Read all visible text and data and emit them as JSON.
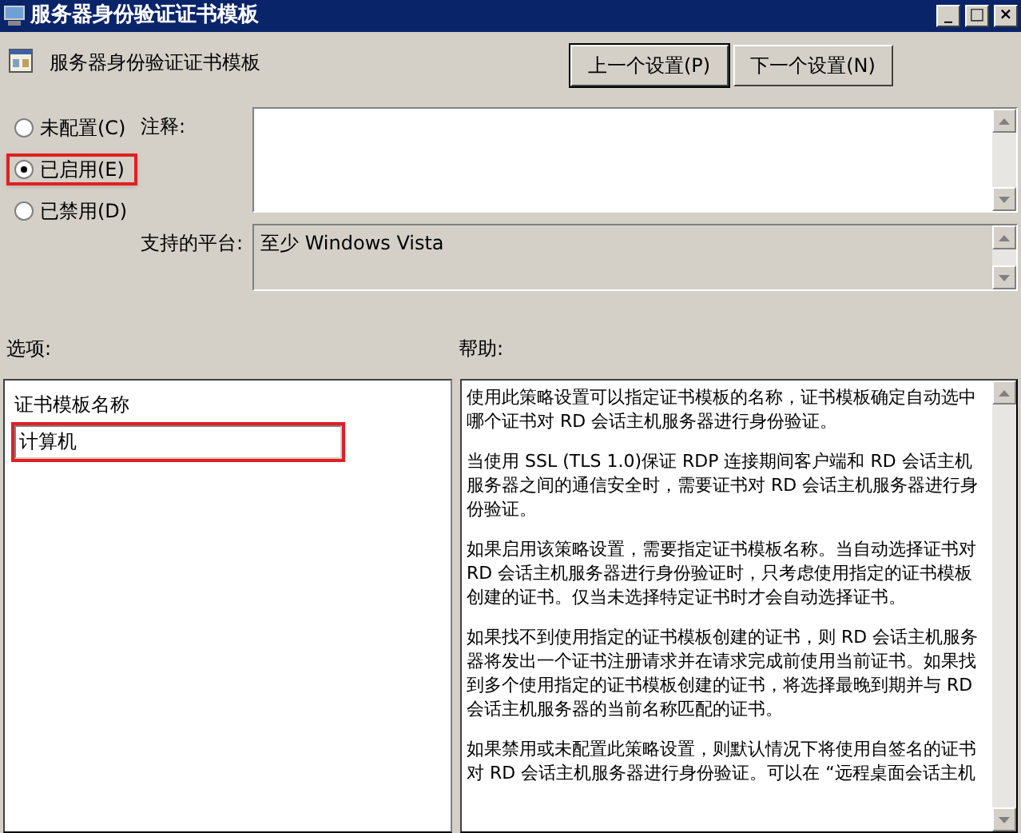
{
  "window": {
    "title": "服务器身份验证证书模板",
    "controls": [
      "_",
      "□",
      "×"
    ]
  },
  "header": {
    "title": "服务器身份验证证书模板"
  },
  "buttons": [
    {
      "label": "上一个设置(P)",
      "focused": true
    },
    {
      "label": "下一个设置(N)",
      "focused": false
    }
  ],
  "state_options": [
    {
      "label": "未配置(C)",
      "selected": false,
      "highlighted": false
    },
    {
      "label": "已启用(E)",
      "selected": true,
      "highlighted": true
    },
    {
      "label": "已禁用(D)",
      "selected": false,
      "highlighted": false
    }
  ],
  "comment": {
    "label": "注释:"
  },
  "platform": {
    "label": "支持的平台:",
    "value": "至少 Windows Vista"
  },
  "options": {
    "label": "选项:",
    "field_label": "证书模板名称",
    "field_value": "计算机",
    "highlighted": true
  },
  "help": {
    "label": "帮助:",
    "paragraphs": [
      "使用此策略设置可以指定证书模板的名称，证书模板确定自动选中哪个证书对 RD 会话主机服务器进行身份验证。",
      "当使用 SSL (TLS 1.0)保证 RDP 连接期间客户端和 RD 会话主机服务器之间的通信安全时，需要证书对 RD 会话主机服务器进行身份验证。",
      "如果启用该策略设置，需要指定证书模板名称。当自动选择证书对 RD 会话主机服务器进行身份验证时，只考虑使用指定的证书模板创建的证书。仅当未选择特定证书时才会自动选择证书。",
      "如果找不到使用指定的证书模板创建的证书，则 RD 会话主机服务器将发出一个证书注册请求并在请求完成前使用当前证书。如果找到多个使用指定的证书模板创建的证书，将选择最晚到期并与 RD 会话主机服务器的当前名称匹配的证书。",
      "如果禁用或未配置此策略设置，则默认情况下将使用自签名的证书对 RD 会话主机服务器进行身份验证。可以在 “远程桌面会话主机"
    ]
  }
}
